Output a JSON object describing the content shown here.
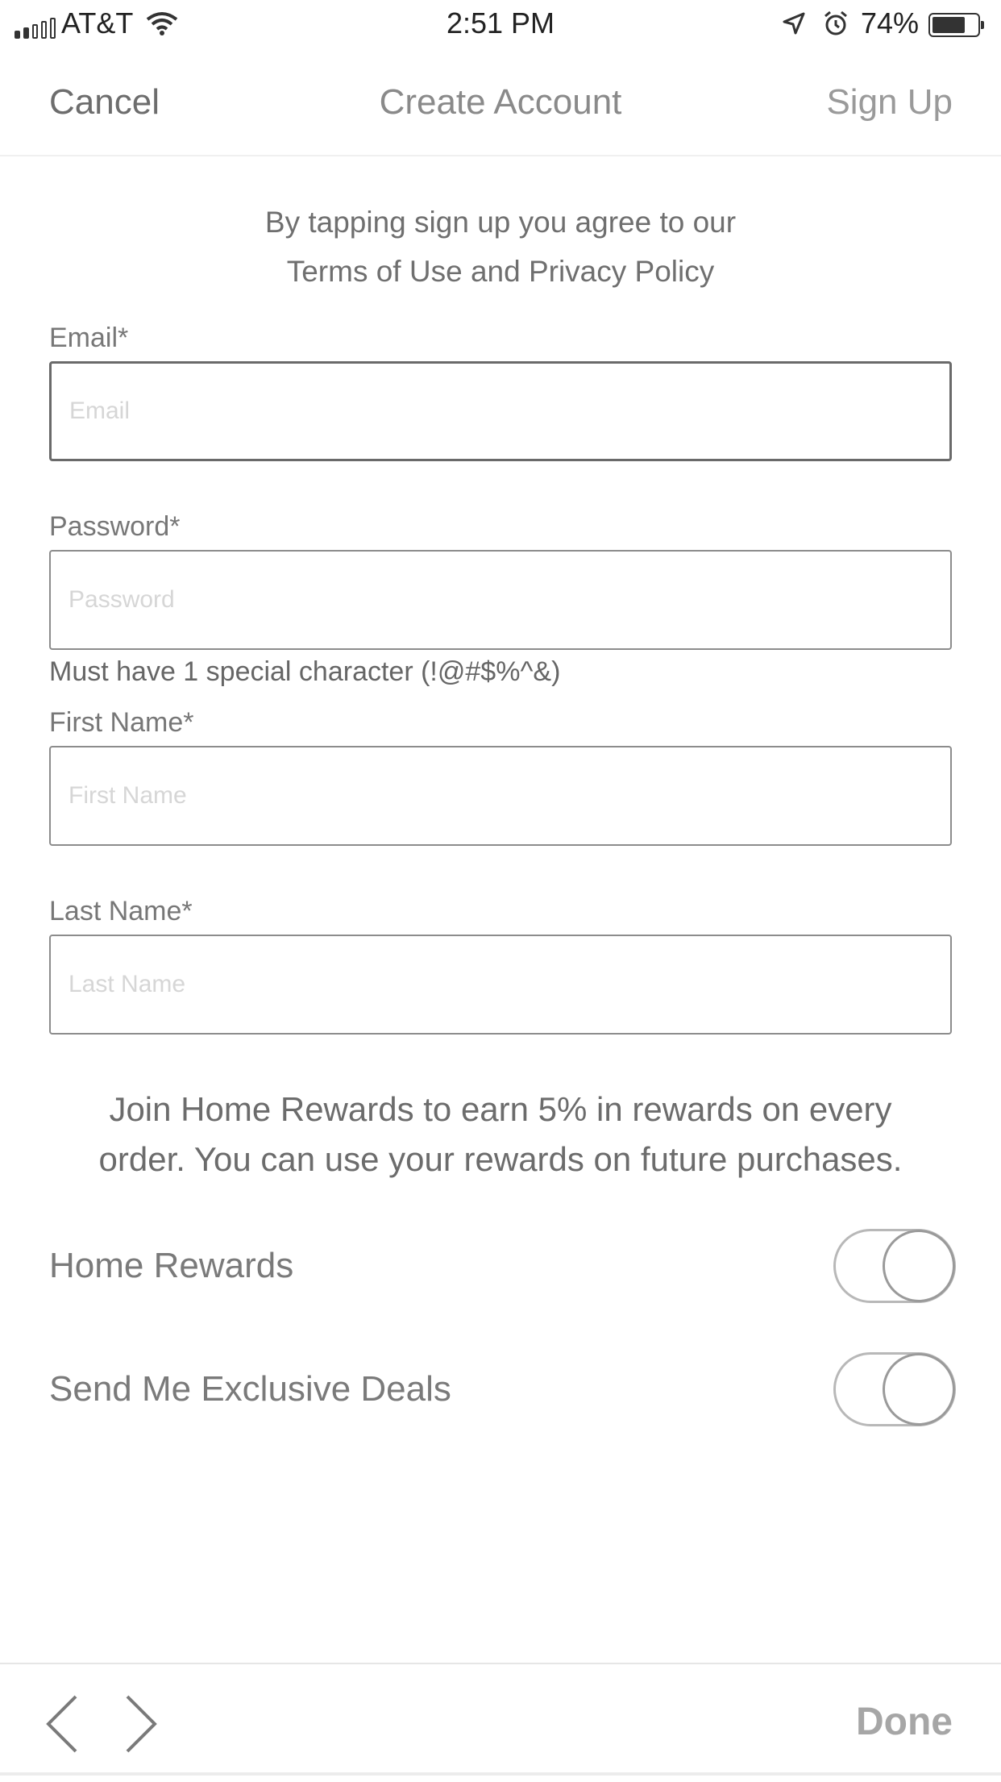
{
  "status_bar": {
    "carrier": "AT&T",
    "time": "2:51 PM",
    "battery": "74%",
    "battery_level": 0.74
  },
  "nav": {
    "cancel": "Cancel",
    "title": "Create Account",
    "sign_up": "Sign Up"
  },
  "agreement": {
    "line1": "By tapping sign up you agree to our",
    "line2": "Terms of Use and Privacy Policy"
  },
  "form": {
    "email": {
      "label": "Email*",
      "placeholder": "Email",
      "value": ""
    },
    "password": {
      "label": "Password*",
      "placeholder": "Password",
      "value": "",
      "hint": "Must have 1 special character (!@#$%^&)"
    },
    "first_name": {
      "label": "First Name*",
      "placeholder": "First Name",
      "value": ""
    },
    "last_name": {
      "label": "Last Name*",
      "placeholder": "Last Name",
      "value": ""
    }
  },
  "rewards": {
    "promo_line1": "Join Home Rewards to earn 5% in rewards on every",
    "promo_line2": "order. You can use your rewards on future purchases.",
    "home_rewards_label": "Home Rewards",
    "home_rewards_on": false,
    "exclusive_deals_label": "Send Me Exclusive Deals",
    "exclusive_deals_on": false
  },
  "keyboard_toolbar": {
    "done": "Done",
    "prev_icon": "chevron-left-icon",
    "next_icon": "chevron-right-icon"
  }
}
